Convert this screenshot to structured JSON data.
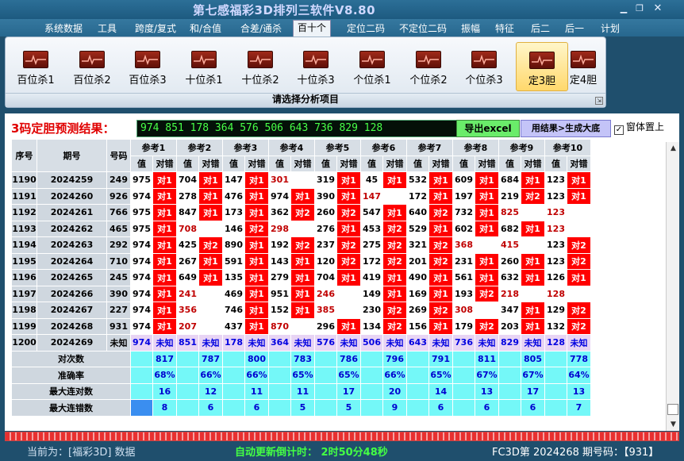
{
  "app": {
    "title": "第七感福彩3D排列三软件V8.80"
  },
  "menu": [
    "系统数据",
    "工具",
    "跨度/复式",
    "和/合值",
    "合差/通杀",
    "百十个",
    "定位二码",
    "不定位二码",
    "振幅",
    "特征",
    "后二",
    "后一",
    "计划"
  ],
  "menu_active": 5,
  "ribbon": {
    "tools": [
      "百位杀1",
      "百位杀2",
      "百位杀3",
      "十位杀1",
      "十位杀2",
      "十位杀3",
      "个位杀1",
      "个位杀2",
      "个位杀3",
      "定3胆",
      "定4胆"
    ],
    "selected": 9,
    "caption": "请选择分析项目"
  },
  "prediction": {
    "label": "3码定胆预测结果：",
    "values": "974 851 178 364 576 506 643 736 829 128",
    "export_button": "导出excel",
    "generate_button": "用结果>生成大底",
    "topmost_label": "窗体置上",
    "topmost_checked": "✓"
  },
  "table": {
    "h_seq": "序号",
    "h_period": "期号",
    "h_num": "号码",
    "ref_headers": [
      "参考1",
      "参考2",
      "参考3",
      "参考4",
      "参考5",
      "参考6",
      "参考7",
      "参考8",
      "参考9",
      "参考10"
    ],
    "sub_value": "值",
    "sub_result": "对错",
    "rows": [
      {
        "seq": "1190",
        "period": "2024259",
        "num": "249",
        "cells": [
          [
            "975",
            "对1"
          ],
          [
            "704",
            "对1"
          ],
          [
            "147",
            "对1"
          ],
          [
            "301",
            ""
          ],
          [
            "319",
            "对1"
          ],
          [
            "45",
            "对1"
          ],
          [
            "532",
            "对1"
          ],
          [
            "609",
            "对1"
          ],
          [
            "684",
            "对1"
          ],
          [
            "123",
            "对1"
          ]
        ]
      },
      {
        "seq": "1191",
        "period": "2024260",
        "num": "926",
        "cells": [
          [
            "974",
            "对1"
          ],
          [
            "278",
            "对1"
          ],
          [
            "476",
            "对1"
          ],
          [
            "974",
            "对1"
          ],
          [
            "390",
            "对1"
          ],
          [
            "147",
            ""
          ],
          [
            "172",
            "对1"
          ],
          [
            "197",
            "对1"
          ],
          [
            "219",
            "对2"
          ],
          [
            "123",
            "对1"
          ]
        ]
      },
      {
        "seq": "1192",
        "period": "2024261",
        "num": "766",
        "cells": [
          [
            "975",
            "对1"
          ],
          [
            "847",
            "对1"
          ],
          [
            "173",
            "对1"
          ],
          [
            "362",
            "对2"
          ],
          [
            "260",
            "对2"
          ],
          [
            "547",
            "对1"
          ],
          [
            "640",
            "对2"
          ],
          [
            "732",
            "对1"
          ],
          [
            "825",
            ""
          ],
          [
            "123",
            ""
          ]
        ]
      },
      {
        "seq": "1193",
        "period": "2024262",
        "num": "465",
        "cells": [
          [
            "975",
            "对1"
          ],
          [
            "708",
            ""
          ],
          [
            "146",
            "对2"
          ],
          [
            "298",
            ""
          ],
          [
            "276",
            "对1"
          ],
          [
            "453",
            "对2"
          ],
          [
            "529",
            "对1"
          ],
          [
            "602",
            "对1"
          ],
          [
            "682",
            "对1"
          ],
          [
            "123",
            ""
          ]
        ]
      },
      {
        "seq": "1194",
        "period": "2024263",
        "num": "292",
        "cells": [
          [
            "974",
            "对1"
          ],
          [
            "425",
            "对2"
          ],
          [
            "890",
            "对1"
          ],
          [
            "192",
            "对2"
          ],
          [
            "237",
            "对2"
          ],
          [
            "275",
            "对2"
          ],
          [
            "321",
            "对2"
          ],
          [
            "368",
            ""
          ],
          [
            "415",
            ""
          ],
          [
            "123",
            "对2"
          ]
        ]
      },
      {
        "seq": "1195",
        "period": "2024264",
        "num": "710",
        "cells": [
          [
            "974",
            "对1"
          ],
          [
            "267",
            "对1"
          ],
          [
            "591",
            "对1"
          ],
          [
            "143",
            "对1"
          ],
          [
            "120",
            "对2"
          ],
          [
            "172",
            "对2"
          ],
          [
            "201",
            "对2"
          ],
          [
            "231",
            "对1"
          ],
          [
            "260",
            "对1"
          ],
          [
            "123",
            "对2"
          ]
        ]
      },
      {
        "seq": "1196",
        "period": "2024265",
        "num": "245",
        "cells": [
          [
            "974",
            "对1"
          ],
          [
            "649",
            "对1"
          ],
          [
            "135",
            "对1"
          ],
          [
            "279",
            "对1"
          ],
          [
            "704",
            "对1"
          ],
          [
            "419",
            "对1"
          ],
          [
            "490",
            "对1"
          ],
          [
            "561",
            "对1"
          ],
          [
            "632",
            "对1"
          ],
          [
            "126",
            "对1"
          ]
        ]
      },
      {
        "seq": "1197",
        "period": "2024266",
        "num": "390",
        "cells": [
          [
            "974",
            "对1"
          ],
          [
            "241",
            ""
          ],
          [
            "469",
            "对1"
          ],
          [
            "951",
            "对1"
          ],
          [
            "246",
            ""
          ],
          [
            "149",
            "对1"
          ],
          [
            "169",
            "对1"
          ],
          [
            "193",
            "对2"
          ],
          [
            "218",
            ""
          ],
          [
            "128",
            ""
          ]
        ]
      },
      {
        "seq": "1198",
        "period": "2024267",
        "num": "227",
        "cells": [
          [
            "974",
            "对1"
          ],
          [
            "356",
            ""
          ],
          [
            "746",
            "对1"
          ],
          [
            "152",
            "对1"
          ],
          [
            "385",
            ""
          ],
          [
            "230",
            "对2"
          ],
          [
            "269",
            "对2"
          ],
          [
            "308",
            ""
          ],
          [
            "347",
            "对1"
          ],
          [
            "129",
            "对2"
          ]
        ]
      },
      {
        "seq": "1199",
        "period": "2024268",
        "num": "931",
        "cells": [
          [
            "974",
            "对1"
          ],
          [
            "207",
            ""
          ],
          [
            "437",
            "对1"
          ],
          [
            "870",
            ""
          ],
          [
            "296",
            "对1"
          ],
          [
            "134",
            "对2"
          ],
          [
            "156",
            "对1"
          ],
          [
            "179",
            "对2"
          ],
          [
            "203",
            "对1"
          ],
          [
            "132",
            "对2"
          ]
        ]
      }
    ],
    "pending": {
      "seq": "1200",
      "period": "2024269",
      "num": "未知",
      "values": [
        "974",
        "851",
        "178",
        "364",
        "576",
        "506",
        "643",
        "736",
        "829",
        "128"
      ],
      "status": "未知"
    },
    "stats": [
      {
        "label": "对次数",
        "values": [
          "817",
          "787",
          "800",
          "783",
          "786",
          "796",
          "791",
          "811",
          "805",
          "778"
        ]
      },
      {
        "label": "准确率",
        "values": [
          "68%",
          "66%",
          "66%",
          "65%",
          "65%",
          "66%",
          "65%",
          "67%",
          "67%",
          "64%"
        ]
      },
      {
        "label": "最大连对数",
        "values": [
          "16",
          "12",
          "11",
          "11",
          "17",
          "20",
          "14",
          "13",
          "17",
          "13"
        ]
      },
      {
        "label": "最大连错数",
        "values": [
          "8",
          "6",
          "6",
          "5",
          "5",
          "9",
          "6",
          "6",
          "6",
          "7"
        ]
      }
    ]
  },
  "status": {
    "left": "当前为：[福彩3D] 数据",
    "mid": "自动更新倒计时：  2时50分48秒",
    "right": "FC3D第 2024268 期号码：【931】"
  }
}
